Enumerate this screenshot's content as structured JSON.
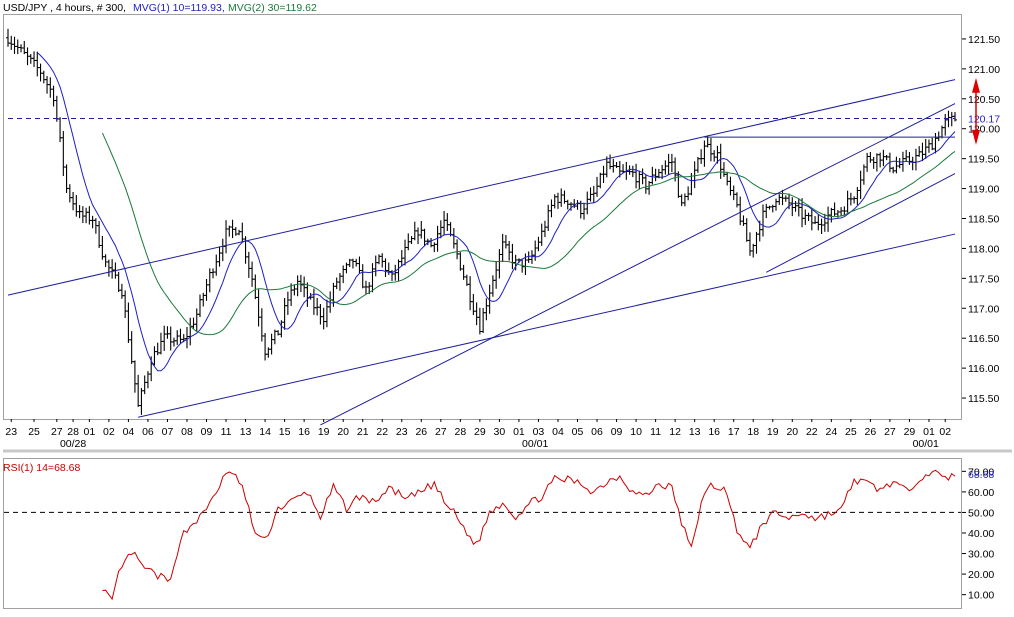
{
  "header": {
    "symbol_text": "USD/JPY , 4 hours, # 300,",
    "ma1_text": "MVG(1) 10=119.93,",
    "ma2_text": "MVG(2) 30=119.62"
  },
  "rsi_header": {
    "label_text": "RSI(1) 14=68.68"
  },
  "colors": {
    "background": "#ffffff",
    "bars": "#000000",
    "ma_fast": "#1e1ec8",
    "ma_slow": "#1a7a3a",
    "trendlines": "#1e1e9a",
    "rsi": "#cc0000",
    "header_text": "#000000",
    "arrow": "#e00000"
  },
  "chart_data": [
    {
      "type": "candlestick",
      "variant": "ohlc-bars",
      "title": "USD/JPY , 4 hours, # 300,",
      "ylim": [
        115.15,
        121.9
      ],
      "yticks": [
        "121.50",
        "121.00",
        "120.50",
        "120.00",
        "119.50",
        "119.00",
        "118.50",
        "118.00",
        "117.50",
        "117.00",
        "116.50",
        "116.00",
        "115.50"
      ],
      "ytick_values": [
        121.5,
        121.0,
        120.5,
        120.0,
        119.5,
        119.0,
        118.5,
        118.0,
        117.5,
        117.0,
        116.5,
        116.0,
        115.5
      ],
      "last_price": {
        "label": "120.17",
        "value": 120.17
      },
      "x_tick_labels": [
        "23",
        "25",
        "27",
        "28",
        "01",
        "02",
        "04",
        "06",
        "07",
        "08",
        "09",
        "11",
        "13",
        "14",
        "15",
        "16",
        "19",
        "20",
        "21",
        "22",
        "23",
        "26",
        "27",
        "28",
        "29",
        "30",
        "01",
        "03",
        "04",
        "05",
        "06",
        "09",
        "10",
        "11",
        "12",
        "13",
        "16",
        "17",
        "18",
        "19",
        "20",
        "22",
        "24",
        "25",
        "26",
        "27",
        "29",
        "01",
        "02"
      ],
      "x_tick_index": [
        1,
        8,
        15,
        20,
        25,
        31,
        37,
        43,
        49,
        55,
        61,
        67,
        73,
        79,
        85,
        91,
        97,
        103,
        109,
        115,
        121,
        127,
        133,
        139,
        145,
        151,
        157,
        163,
        169,
        175,
        181,
        187,
        193,
        199,
        205,
        211,
        217,
        223,
        229,
        235,
        241,
        247,
        253,
        259,
        265,
        271,
        277,
        283,
        288
      ],
      "month_labels": [
        {
          "label": "00/28",
          "index": 20
        },
        {
          "label": "00/01",
          "index": 162
        },
        {
          "label": "00/01",
          "index": 282
        }
      ],
      "bar_count": 292,
      "anchors": [
        [
          0,
          121.52
        ],
        [
          10,
          120.95
        ],
        [
          14,
          120.55
        ],
        [
          18,
          119.0
        ],
        [
          22,
          118.55
        ],
        [
          26,
          118.5
        ],
        [
          30,
          117.75
        ],
        [
          35,
          117.3
        ],
        [
          40,
          115.35
        ],
        [
          44,
          116.15
        ],
        [
          48,
          116.5
        ],
        [
          54,
          116.45
        ],
        [
          58,
          116.9
        ],
        [
          62,
          117.55
        ],
        [
          67,
          118.25
        ],
        [
          71,
          118.35
        ],
        [
          75,
          117.5
        ],
        [
          79,
          116.3
        ],
        [
          83,
          116.6
        ],
        [
          86,
          117.15
        ],
        [
          89,
          117.45
        ],
        [
          93,
          117.1
        ],
        [
          97,
          116.85
        ],
        [
          101,
          117.45
        ],
        [
          106,
          117.8
        ],
        [
          110,
          117.3
        ],
        [
          114,
          117.85
        ],
        [
          118,
          117.5
        ],
        [
          122,
          117.95
        ],
        [
          126,
          118.3
        ],
        [
          130,
          118.05
        ],
        [
          134,
          118.45
        ],
        [
          138,
          117.9
        ],
        [
          142,
          117.2
        ],
        [
          145,
          116.7
        ],
        [
          149,
          117.5
        ],
        [
          152,
          118.05
        ],
        [
          156,
          117.75
        ],
        [
          160,
          117.75
        ],
        [
          164,
          118.25
        ],
        [
          168,
          118.85
        ],
        [
          172,
          118.8
        ],
        [
          176,
          118.65
        ],
        [
          180,
          118.9
        ],
        [
          184,
          119.4
        ],
        [
          188,
          119.25
        ],
        [
          192,
          119.25
        ],
        [
          196,
          119.05
        ],
        [
          200,
          119.3
        ],
        [
          204,
          119.45
        ],
        [
          207,
          118.7
        ],
        [
          211,
          119.25
        ],
        [
          214,
          119.75
        ],
        [
          218,
          119.55
        ],
        [
          221,
          119.05
        ],
        [
          224,
          118.7
        ],
        [
          228,
          117.95
        ],
        [
          232,
          118.55
        ],
        [
          236,
          118.85
        ],
        [
          240,
          118.75
        ],
        [
          244,
          118.55
        ],
        [
          248,
          118.4
        ],
        [
          252,
          118.55
        ],
        [
          256,
          118.65
        ],
        [
          260,
          118.9
        ],
        [
          264,
          119.5
        ],
        [
          268,
          119.55
        ],
        [
          272,
          119.35
        ],
        [
          276,
          119.45
        ],
        [
          280,
          119.55
        ],
        [
          284,
          119.75
        ],
        [
          288,
          120.1
        ],
        [
          291,
          120.17
        ]
      ],
      "series": [
        {
          "name": "MVG(1) 10",
          "last": 119.93,
          "period": 10
        },
        {
          "name": "MVG(2) 30",
          "last": 119.62,
          "period": 30
        }
      ],
      "trendlines": [
        {
          "from": [
            0,
            117.22
          ],
          "to": [
            291,
            120.82
          ]
        },
        {
          "from": [
            40,
            115.18
          ],
          "to": [
            291,
            118.24
          ]
        },
        {
          "from": [
            96,
            115.05
          ],
          "to": [
            291,
            120.42
          ]
        },
        {
          "from": [
            233,
            117.6
          ],
          "to": [
            291,
            119.25
          ]
        },
        {
          "from": [
            214,
            119.86
          ],
          "to": [
            291,
            119.86
          ]
        },
        {
          "from": [
            0,
            120.17
          ],
          "to": [
            291,
            120.17
          ],
          "style": "dashed"
        }
      ]
    },
    {
      "type": "line",
      "title": "RSI(1) 14=68.68",
      "ylim": [
        3.5,
        76
      ],
      "yticks": [
        "70.00",
        "60.00",
        "50.00",
        "40.00",
        "30.00",
        "20.00",
        "10.00"
      ],
      "ytick_values": [
        70,
        60,
        50,
        40,
        30,
        20,
        10
      ],
      "last_value": {
        "label": "68.68",
        "value": 68.68
      },
      "midline": 50,
      "start_index": 29,
      "anchors": [
        [
          29,
          14
        ],
        [
          32,
          6
        ],
        [
          34,
          20
        ],
        [
          38,
          31
        ],
        [
          41,
          24
        ],
        [
          45,
          20
        ],
        [
          50,
          16
        ],
        [
          53,
          38
        ],
        [
          57,
          45
        ],
        [
          60,
          49
        ],
        [
          66,
          66
        ],
        [
          69,
          70
        ],
        [
          72,
          62
        ],
        [
          76,
          40
        ],
        [
          79,
          36
        ],
        [
          83,
          52
        ],
        [
          88,
          56
        ],
        [
          92,
          60
        ],
        [
          96,
          48
        ],
        [
          100,
          62
        ],
        [
          104,
          52
        ],
        [
          108,
          58
        ],
        [
          112,
          55
        ],
        [
          118,
          62
        ],
        [
          122,
          56
        ],
        [
          127,
          60
        ],
        [
          131,
          64
        ],
        [
          134,
          55
        ],
        [
          137,
          50
        ],
        [
          141,
          40
        ],
        [
          144,
          34
        ],
        [
          148,
          50
        ],
        [
          152,
          55
        ],
        [
          156,
          48
        ],
        [
          160,
          54
        ],
        [
          164,
          58
        ],
        [
          168,
          66
        ],
        [
          172,
          66
        ],
        [
          176,
          64
        ],
        [
          180,
          60
        ],
        [
          184,
          65
        ],
        [
          188,
          68
        ],
        [
          192,
          60
        ],
        [
          196,
          58
        ],
        [
          200,
          64
        ],
        [
          204,
          62
        ],
        [
          207,
          45
        ],
        [
          210,
          32
        ],
        [
          213,
          55
        ],
        [
          216,
          63
        ],
        [
          220,
          62
        ],
        [
          224,
          42
        ],
        [
          228,
          32
        ],
        [
          232,
          45
        ],
        [
          236,
          50
        ],
        [
          240,
          47
        ],
        [
          244,
          50
        ],
        [
          248,
          47
        ],
        [
          252,
          49
        ],
        [
          256,
          51
        ],
        [
          260,
          66
        ],
        [
          264,
          64
        ],
        [
          268,
          61
        ],
        [
          272,
          65
        ],
        [
          276,
          60
        ],
        [
          280,
          67
        ],
        [
          284,
          70
        ],
        [
          288,
          66
        ],
        [
          291,
          68.68
        ]
      ]
    }
  ]
}
